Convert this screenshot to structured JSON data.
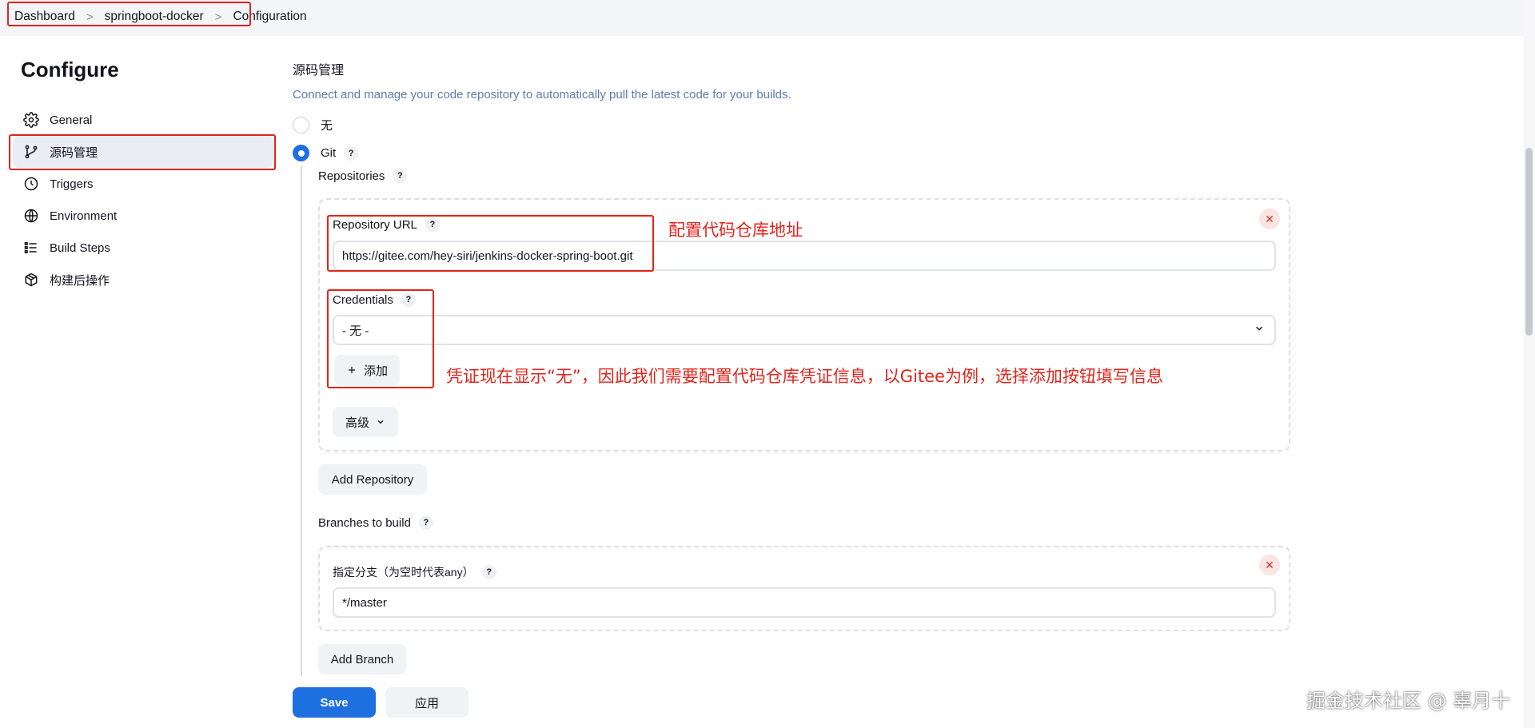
{
  "breadcrumb": {
    "items": [
      "Dashboard",
      "springboot-docker",
      "Configuration"
    ],
    "separator": ">"
  },
  "sidebar": {
    "heading": "Configure",
    "items": [
      {
        "label": "General",
        "icon": "gear-icon"
      },
      {
        "label": "源码管理",
        "icon": "git-branch-icon",
        "active": true
      },
      {
        "label": "Triggers",
        "icon": "clock-icon"
      },
      {
        "label": "Environment",
        "icon": "globe-icon"
      },
      {
        "label": "Build Steps",
        "icon": "list-icon"
      },
      {
        "label": "构建后操作",
        "icon": "package-icon"
      }
    ]
  },
  "scm": {
    "title": "源码管理",
    "description": "Connect and manage your code repository to automatically pull the latest code for your builds.",
    "option_none": "无",
    "option_git": "Git",
    "selected": "Git",
    "repositories_label": "Repositories",
    "repository_url_label": "Repository URL",
    "repository_url_value": "https://gitee.com/hey-siri/jenkins-docker-spring-boot.git",
    "credentials_label": "Credentials",
    "credentials_value": "- 无 -",
    "add_credentials_label": "添加",
    "advanced_label": "高级",
    "add_repository_label": "Add Repository",
    "branches_label": "Branches to build",
    "branch_specifier_label": "指定分支（为空时代表any）",
    "branch_specifier_value": "*/master",
    "add_branch_label": "Add Branch",
    "help_glyph": "?",
    "remove_glyph": "✕"
  },
  "footer": {
    "save_label": "Save",
    "apply_label": "应用"
  },
  "annotations": {
    "repo_url_note": "配置代码仓库地址",
    "credentials_note": "凭证现在显示“无”，因此我们需要配置代码仓库凭证信息，以Gitee为例，选择添加按钮填写信息"
  },
  "watermark": "掘金技术社区 @ 辜月十",
  "colors": {
    "accent": "#1e6fe0",
    "annotation_red": "#e0241c",
    "description_blue": "#5b7db0"
  }
}
